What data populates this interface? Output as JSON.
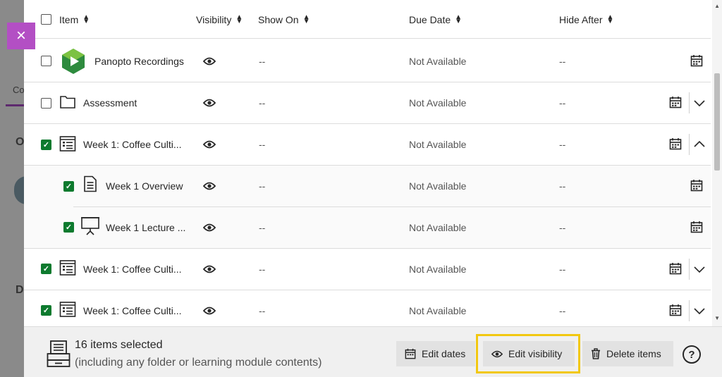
{
  "background": {
    "tab_fragment": "Co",
    "letter_o": "O",
    "letter_d": "D"
  },
  "close": {
    "glyph": "×"
  },
  "columns": {
    "item": "Item",
    "visibility": "Visibility",
    "show_on": "Show On",
    "due_date": "Due Date",
    "hide_after": "Hide After"
  },
  "rows": [
    {
      "name": "Panopto Recordings",
      "icon": "panopto-logo-icon",
      "checked": false,
      "show_on": "--",
      "due_date": "Not Available",
      "hide_after": "--",
      "chevron": "none"
    },
    {
      "name": "Assessment",
      "icon": "folder-icon",
      "checked": false,
      "show_on": "--",
      "due_date": "Not Available",
      "hide_after": "--",
      "chevron": "down"
    },
    {
      "name": "Week 1: Coffee Culti...",
      "icon": "learning-module-icon",
      "checked": true,
      "show_on": "--",
      "due_date": "Not Available",
      "hide_after": "--",
      "chevron": "up"
    },
    {
      "name": "Week 1 Overview",
      "icon": "document-icon",
      "checked": true,
      "show_on": "--",
      "due_date": "Not Available",
      "hide_after": "--",
      "chevron": "none"
    },
    {
      "name": "Week 1 Lecture ...",
      "icon": "presentation-icon",
      "checked": true,
      "show_on": "--",
      "due_date": "Not Available",
      "hide_after": "--",
      "chevron": "none"
    },
    {
      "name": "Week 1: Coffee Culti...",
      "icon": "learning-module-icon",
      "checked": true,
      "show_on": "--",
      "due_date": "Not Available",
      "hide_after": "--",
      "chevron": "down"
    },
    {
      "name": "Week 1: Coffee Culti...",
      "icon": "learning-module-icon",
      "checked": true,
      "show_on": "--",
      "due_date": "Not Available",
      "hide_after": "--",
      "chevron": "down"
    }
  ],
  "footer": {
    "selected_count": "16 items selected",
    "selected_note": "(including any folder or learning module contents)",
    "edit_dates": "Edit dates",
    "edit_visibility": "Edit visibility",
    "delete_items": "Delete items",
    "help": "?"
  },
  "colors": {
    "accent_purple": "#b34fc4",
    "check_green": "#0d7a2e",
    "highlight_yellow": "#f2c811"
  }
}
